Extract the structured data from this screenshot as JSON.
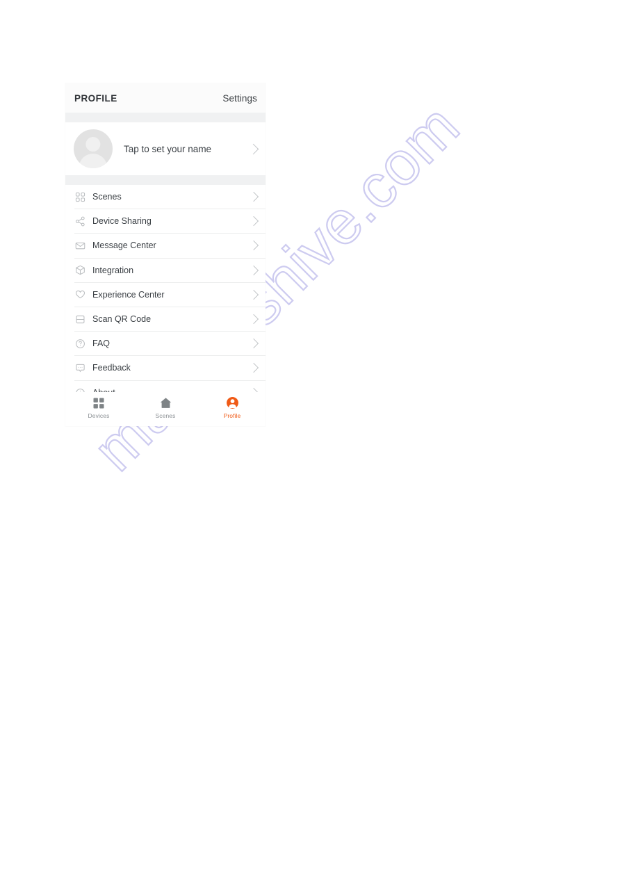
{
  "watermark": {
    "text": "manualshive.com",
    "color": "#cdcbf0"
  },
  "app": {
    "header": {
      "title": "PROFILE",
      "settings_label": "Settings"
    },
    "profile_card": {
      "name_placeholder": "Tap to set your name",
      "avatar_icon": "person-avatar-icon",
      "chevron_icon": "chevron-right-icon"
    },
    "menu": {
      "items": [
        {
          "label": "Scenes",
          "icon": "grid-squares-icon"
        },
        {
          "label": "Device Sharing",
          "icon": "share-nodes-icon"
        },
        {
          "label": "Message Center",
          "icon": "envelope-icon"
        },
        {
          "label": "Integration",
          "icon": "cube-icon"
        },
        {
          "label": "Experience Center",
          "icon": "heart-icon"
        },
        {
          "label": "Scan QR Code",
          "icon": "scan-code-icon"
        },
        {
          "label": "FAQ",
          "icon": "question-circle-icon"
        },
        {
          "label": "Feedback",
          "icon": "speech-bubble-icon"
        },
        {
          "label": "About",
          "icon": "info-circle-icon"
        }
      ]
    },
    "tabbar": {
      "active_color": "#f05a16",
      "inactive_color": "#8b9094",
      "tabs": [
        {
          "label": "Devices",
          "icon": "grid-filled-icon",
          "active": false
        },
        {
          "label": "Scenes",
          "icon": "home-filled-icon",
          "active": false
        },
        {
          "label": "Profile",
          "icon": "person-filled-icon",
          "active": true
        }
      ]
    }
  }
}
